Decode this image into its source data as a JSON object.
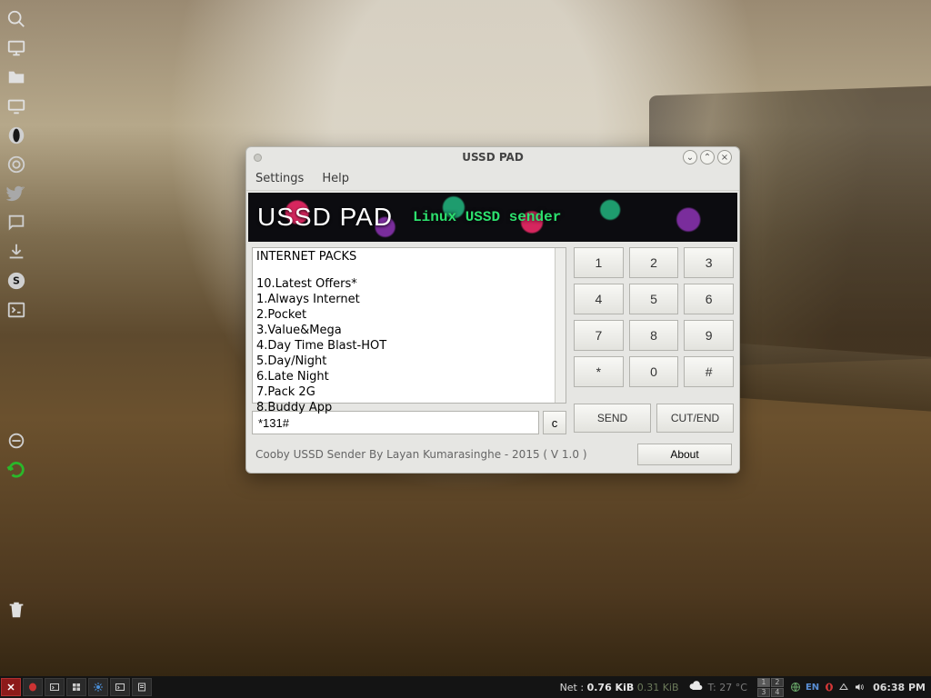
{
  "dock": {
    "icons": [
      "search",
      "monitor",
      "folder",
      "display",
      "opera",
      "chrome",
      "twitter",
      "chat",
      "download",
      "skype",
      "terminal",
      "minus",
      "refresh",
      "trash"
    ]
  },
  "window": {
    "title": "USSD PAD",
    "menu": {
      "settings": "Settings",
      "help": "Help"
    },
    "banner": {
      "title": "USSD PAD",
      "subtitle": "Linux USSD sender"
    },
    "messages": {
      "header": "INTERNET PACKS",
      "lines": [
        "10.Latest Offers*",
        "1.Always Internet",
        "2.Pocket",
        "3.Value&Mega",
        "4.Day Time Blast-HOT",
        "5.Day/Night",
        "6.Late Night",
        "7.Pack 2G",
        "8.Buddy App"
      ]
    },
    "input_value": "*131#",
    "clear": "c",
    "keypad": [
      [
        "1",
        "2",
        "3"
      ],
      [
        "4",
        "5",
        "6"
      ],
      [
        "7",
        "8",
        "9"
      ],
      [
        "*",
        "0",
        "#"
      ]
    ],
    "send": "SEND",
    "cutend": "CUT/END",
    "footer": "Cooby USSD Sender By Layan Kumarasinghe - 2015 ( V 1.0 )",
    "about": "About"
  },
  "taskbar": {
    "net_label": "Net :",
    "net_up": "0.76 KiB",
    "net_down": "0.31 KiB",
    "temp": "T: 27 °C",
    "workspaces": [
      "1",
      "2",
      "3",
      "4"
    ],
    "lang": "EN",
    "clock": "06:38 PM"
  }
}
